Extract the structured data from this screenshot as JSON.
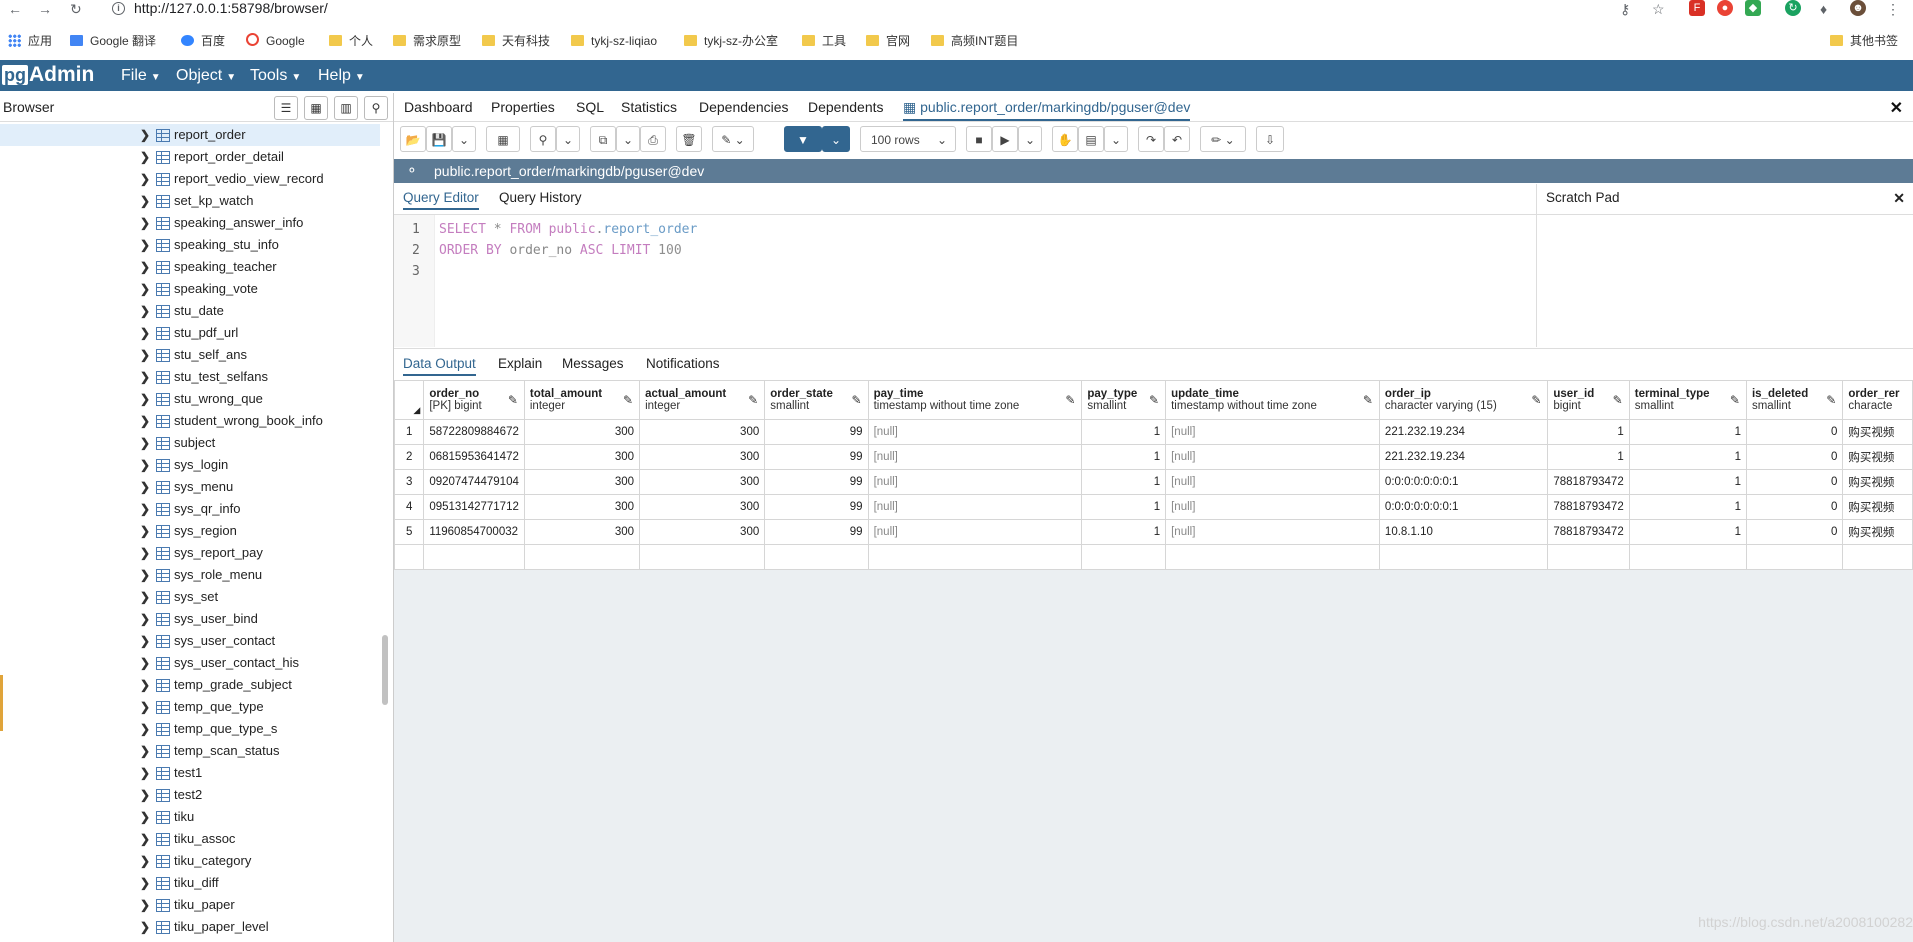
{
  "browser_chrome": {
    "url": "http://127.0.0.1:58798/browser/",
    "bookmarks": [
      "应用",
      "Google 翻译",
      "百度",
      "Google",
      "个人",
      "需求原型",
      "天有科技",
      "tykj-sz-liqiao",
      "tykj-sz-办公室",
      "工具",
      "官网",
      "高频INT题目"
    ],
    "other_bookmarks": "其他书签"
  },
  "app": {
    "logo_pg": "pg",
    "logo_rest": "Admin",
    "menus": [
      "File",
      "Object",
      "Tools",
      "Help"
    ]
  },
  "browser_panel": {
    "title": "Browser",
    "tree_items": [
      "report_order",
      "report_order_detail",
      "report_vedio_view_record",
      "set_kp_watch",
      "speaking_answer_info",
      "speaking_stu_info",
      "speaking_teacher",
      "speaking_vote",
      "stu_date",
      "stu_pdf_url",
      "stu_self_ans",
      "stu_test_selfans",
      "stu_wrong_que",
      "student_wrong_book_info",
      "subject",
      "sys_login",
      "sys_menu",
      "sys_qr_info",
      "sys_region",
      "sys_report_pay",
      "sys_role_menu",
      "sys_set",
      "sys_user_bind",
      "sys_user_contact",
      "sys_user_contact_his",
      "temp_grade_subject",
      "temp_que_type",
      "temp_que_type_s",
      "temp_scan_status",
      "test1",
      "test2",
      "tiku",
      "tiku_assoc",
      "tiku_category",
      "tiku_diff",
      "tiku_paper",
      "tiku_paper_level"
    ],
    "selected_index": 0
  },
  "tabs": [
    "Dashboard",
    "Properties",
    "SQL",
    "Statistics",
    "Dependencies",
    "Dependents"
  ],
  "active_tab": "public.report_order/markingdb/pguser@dev",
  "toolbar": {
    "rows_limit": "100 rows"
  },
  "connection": "public.report_order/markingdb/pguser@dev",
  "editor_tabs": [
    "Query Editor",
    "Query History"
  ],
  "scratch_pad": "Scratch Pad",
  "query": {
    "line_numbers": [
      "1",
      "2",
      "3"
    ],
    "l1_select": "SELECT",
    "l1_star": " * ",
    "l1_from": "FROM",
    "l1_schema": " public",
    "l1_dot": ".",
    "l1_table": "report_order",
    "l2_order": "ORDER BY",
    "l2_col": " order_no ",
    "l2_asc": "ASC",
    "l2_sp": " ",
    "l2_limit": "LIMIT",
    "l2_num": " 100"
  },
  "output_tabs": [
    "Data Output",
    "Explain",
    "Messages",
    "Notifications"
  ],
  "grid": {
    "columns": [
      {
        "name": "order_no",
        "type": "[PK] bigint"
      },
      {
        "name": "total_amount",
        "type": "integer"
      },
      {
        "name": "actual_amount",
        "type": "integer"
      },
      {
        "name": "order_state",
        "type": "smallint"
      },
      {
        "name": "pay_time",
        "type": "timestamp without time zone"
      },
      {
        "name": "pay_type",
        "type": "smallint"
      },
      {
        "name": "update_time",
        "type": "timestamp without time zone"
      },
      {
        "name": "order_ip",
        "type": "character varying (15)"
      },
      {
        "name": "user_id",
        "type": "bigint"
      },
      {
        "name": "terminal_type",
        "type": "smallint"
      },
      {
        "name": "is_deleted",
        "type": "smallint"
      },
      {
        "name": "order_rer",
        "type": "characte"
      }
    ],
    "rows": [
      [
        "1",
        "58722809884672",
        "300",
        "300",
        "99",
        "[null]",
        "1",
        "[null]",
        "221.232.19.234",
        "1",
        "1",
        "0",
        "购买视频"
      ],
      [
        "2",
        "06815953641472",
        "300",
        "300",
        "99",
        "[null]",
        "1",
        "[null]",
        "221.232.19.234",
        "1",
        "1",
        "0",
        "购买视频"
      ],
      [
        "3",
        "09207474479104",
        "300",
        "300",
        "99",
        "[null]",
        "1",
        "[null]",
        "0:0:0:0:0:0:0:1",
        "78818793472",
        "1",
        "0",
        "购买视频"
      ],
      [
        "4",
        "09513142771712",
        "300",
        "300",
        "99",
        "[null]",
        "1",
        "[null]",
        "0:0:0:0:0:0:0:1",
        "78818793472",
        "1",
        "0",
        "购买视频"
      ],
      [
        "5",
        "11960854700032",
        "300",
        "300",
        "99",
        "[null]",
        "1",
        "[null]",
        "10.8.1.10",
        "78818793472",
        "1",
        "0",
        "购买视频"
      ]
    ]
  },
  "watermark": "https://blog.csdn.net/a2008100282"
}
